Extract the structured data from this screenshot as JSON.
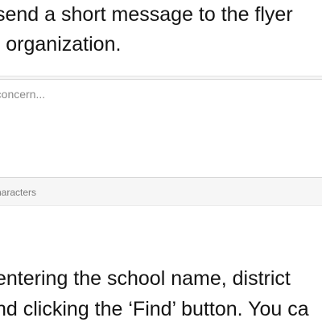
{
  "document": {
    "line1": "send a short message to the flyer",
    "line2": "r organization.",
    "line3": "entering the school name, district",
    "line4": "nd clicking the ‘Find’ button. You ca"
  },
  "message_form": {
    "placeholder": "ay concern...",
    "char_counter": "haracters"
  }
}
